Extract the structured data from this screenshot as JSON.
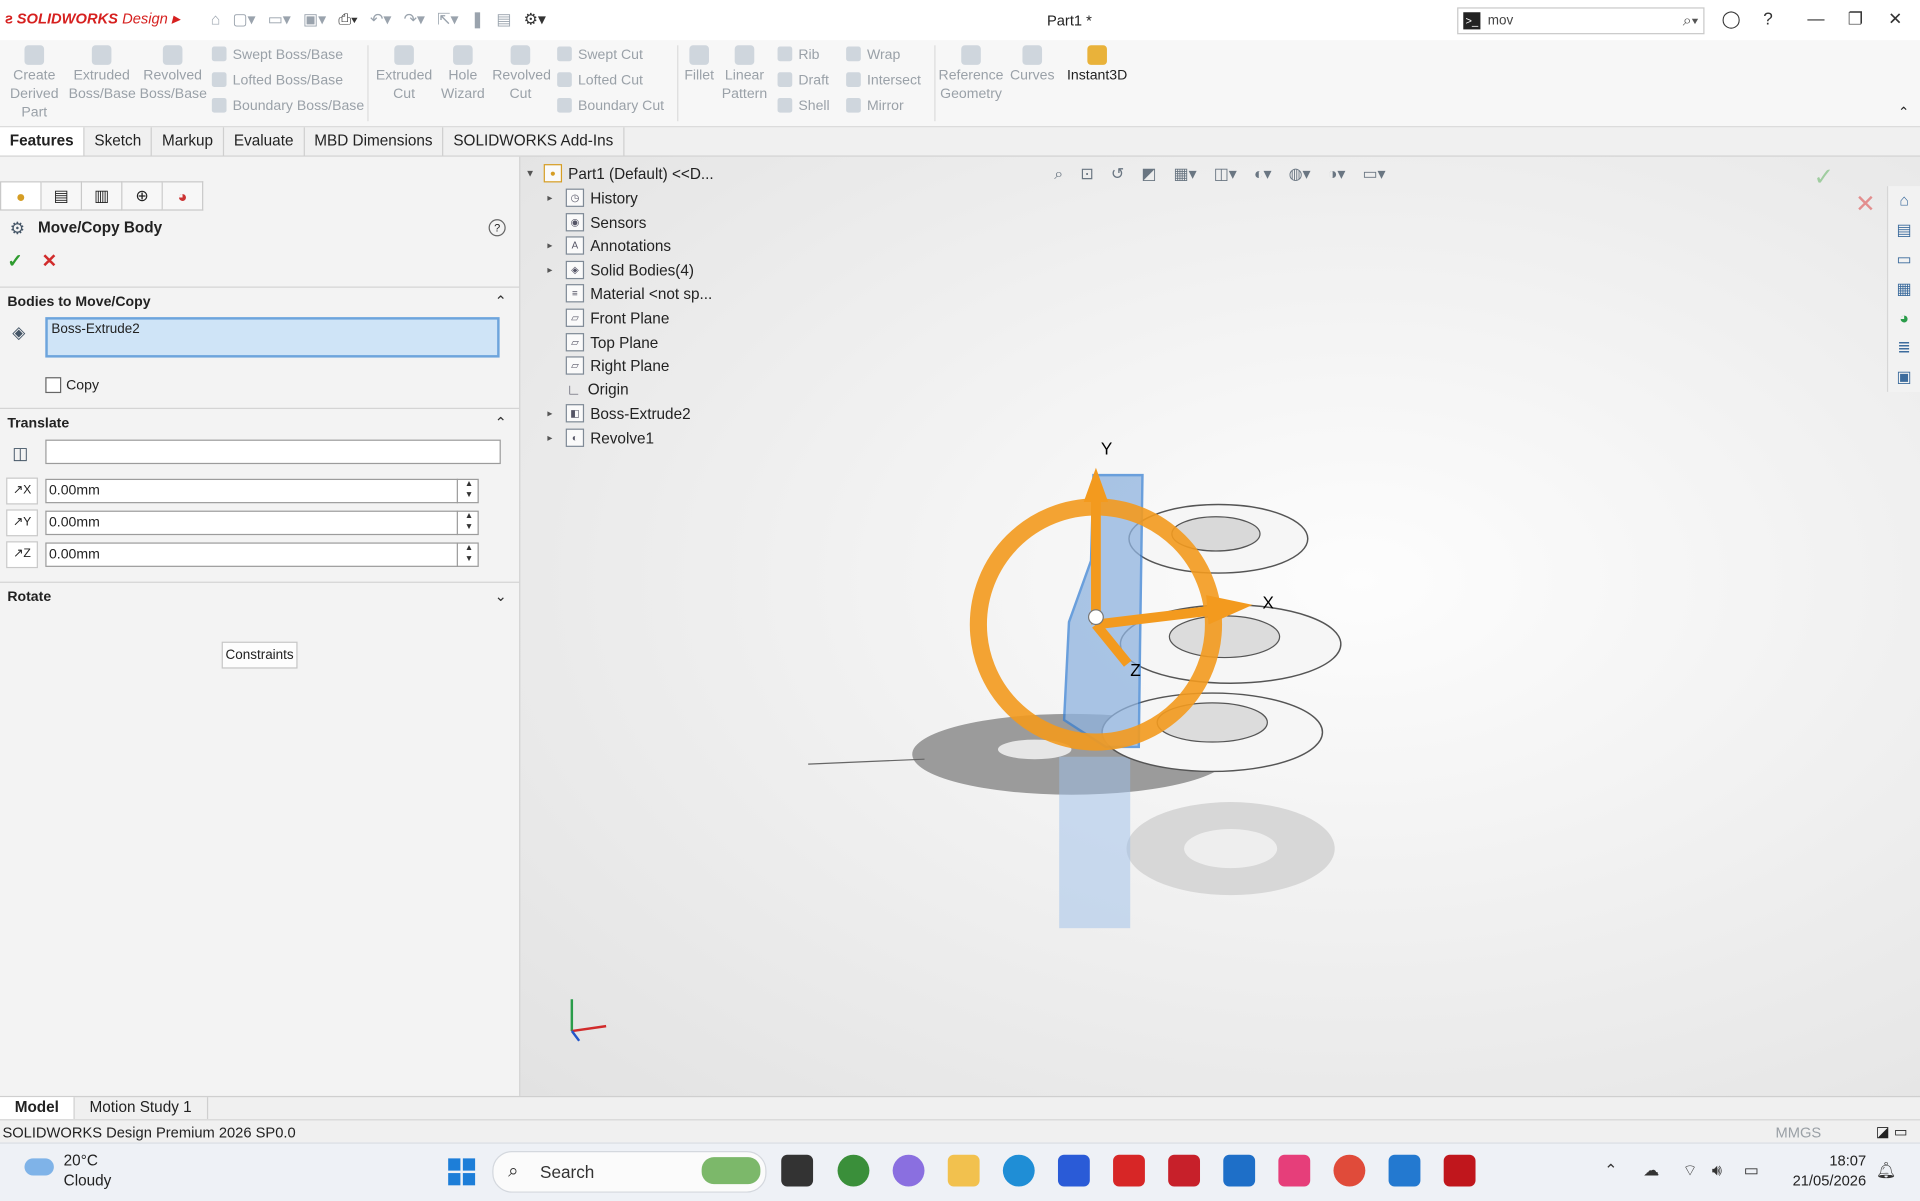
{
  "app": {
    "brand": "SOLIDWORKS",
    "brand_suffix": "Design",
    "doc_title": "Part1 *",
    "search_value": "mov"
  },
  "ribbon": {
    "create_derived_part": "Create Derived Part",
    "extruded_boss": "Extruded Boss/Base",
    "revolved_boss": "Revolved Boss/Base",
    "swept_boss": "Swept Boss/Base",
    "lofted_boss": "Lofted Boss/Base",
    "boundary_boss": "Boundary Boss/Base",
    "extruded_cut": "Extruded Cut",
    "hole_wizard": "Hole Wizard",
    "revolved_cut": "Revolved Cut",
    "swept_cut": "Swept Cut",
    "lofted_cut": "Lofted Cut",
    "boundary_cut": "Boundary Cut",
    "fillet": "Fillet",
    "linear_pattern": "Linear Pattern",
    "rib": "Rib",
    "draft": "Draft",
    "shell": "Shell",
    "wrap": "Wrap",
    "intersect": "Intersect",
    "mirror": "Mirror",
    "reference_geometry": "Reference Geometry",
    "curves": "Curves",
    "instant3d": "Instant3D"
  },
  "tabs": [
    "Features",
    "Sketch",
    "Markup",
    "Evaluate",
    "MBD Dimensions",
    "SOLIDWORKS Add-Ins"
  ],
  "property_manager": {
    "title": "Move/Copy Body",
    "bodies_section": "Bodies to Move/Copy",
    "selected_body": "Boss-Extrude2",
    "copy_label": "Copy",
    "translate_section": "Translate",
    "dx": "0.00mm",
    "dy": "0.00mm",
    "dz": "0.00mm",
    "rotate_section": "Rotate",
    "constraints_button": "Constraints"
  },
  "tree": {
    "root": "Part1 (Default) <<D...",
    "items": [
      "History",
      "Sensors",
      "Annotations",
      "Solid Bodies(4)",
      "Material <not sp...",
      "Front Plane",
      "Top Plane",
      "Right Plane",
      "Origin",
      "Boss-Extrude2",
      "Revolve1"
    ]
  },
  "triad": {
    "x": "X",
    "y": "Y",
    "z": "Z"
  },
  "bottom_tabs": [
    "Model",
    "Motion Study 1"
  ],
  "status": {
    "text": "SOLIDWORKS Design Premium 2026 SP0.0",
    "units": "MMGS"
  },
  "taskbar": {
    "temperature": "20°C",
    "weather": "Cloudy",
    "search": "Search",
    "time": "18:07",
    "date": "21/05/2026"
  },
  "colors": {
    "brand_red": "#d6201f",
    "selection_blue": "#cfe4f7",
    "triad_orange": "#f39a1e"
  }
}
